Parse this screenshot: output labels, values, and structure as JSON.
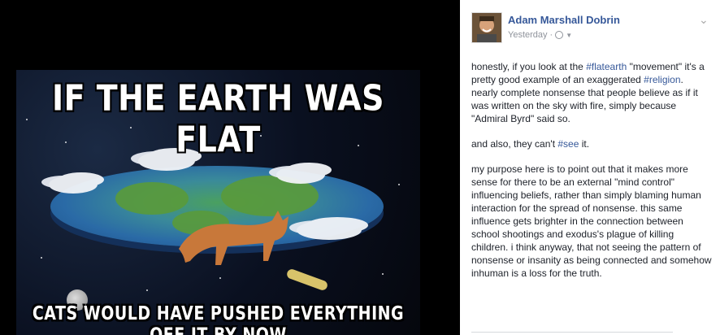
{
  "photo": {
    "top_text": "IF THE EARTH WAS FLAT",
    "bottom_text": "CATS WOULD HAVE PUSHED EVERYTHING OFF IT BY NOW"
  },
  "post": {
    "author": "Adam Marshall Dobrin",
    "timestamp": "Yesterday",
    "privacy_icon": "globe-icon",
    "p1": {
      "a": "honestly, if you look at the ",
      "tag1": "#flatearth",
      "b": " \"movement\" it's a pretty good example of an exaggerated ",
      "tag2": "#religion",
      "c": ". nearly complete nonsense that people believe as if it was written on the sky with fire, simply because \"Admiral Byrd\" said so."
    },
    "p2": {
      "a": "and also, they can't ",
      "tag": "#see",
      "b": " it."
    },
    "p3": "my purpose here is to point out that it makes more sense for there to be an external \"mind control\" influencing beliefs, rather than simply blaming human interaction for the spread of nonsense. this same influence gets brighter in the connection between school shootings and exodus's plague of killing children. i think anyway, that not seeing the pattern of nonsense or insanity as being connected and somehow inhuman is a loss for the truth."
  },
  "colors": {
    "link": "#365899",
    "text": "#1d2129",
    "meta": "#90949c",
    "viewer_bg": "#000000"
  }
}
